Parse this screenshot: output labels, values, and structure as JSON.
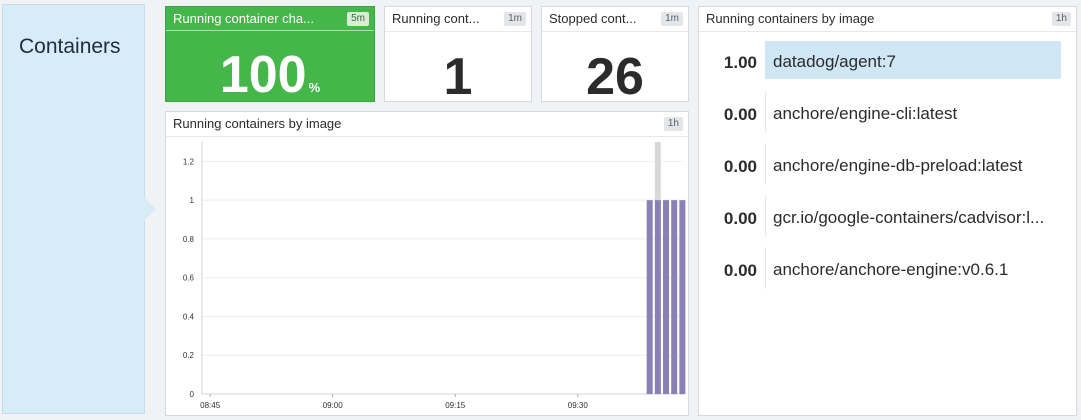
{
  "group": {
    "title": "Containers"
  },
  "change_widget": {
    "title": "Running container cha...",
    "badge": "5m",
    "value": "100",
    "unit": "%"
  },
  "running_widget": {
    "title": "Running cont...",
    "badge": "1m",
    "value": "1"
  },
  "stopped_widget": {
    "title": "Stopped cont...",
    "badge": "1m",
    "value": "26"
  },
  "timeseries_widget": {
    "title": "Running containers by image",
    "badge": "1h"
  },
  "toplist_widget": {
    "title": "Running containers by image",
    "badge": "1h",
    "rows": [
      {
        "value": "1.00",
        "name": "datadog/agent:7",
        "fraction": 1.0
      },
      {
        "value": "0.00",
        "name": "anchore/engine-cli:latest",
        "fraction": 0
      },
      {
        "value": "0.00",
        "name": "anchore/engine-db-preload:latest",
        "fraction": 0
      },
      {
        "value": "0.00",
        "name": "gcr.io/google-containers/cadvisor:l...",
        "fraction": 0
      },
      {
        "value": "0.00",
        "name": "anchore/anchore-engine:v0.6.1",
        "fraction": 0
      }
    ]
  },
  "chart_data": {
    "type": "bar",
    "title": "Running containers by image",
    "ylim": [
      0,
      1.3
    ],
    "y_ticks": [
      "0",
      "0.2",
      "0.4",
      "0.6",
      "0.8",
      "1",
      "1.2"
    ],
    "x_ticks": [
      "08:45",
      "09:00",
      "09:15",
      "09:30"
    ],
    "x_tick_minutes": [
      0,
      15,
      30,
      45
    ],
    "x_range_minutes": [
      -1,
      58
    ],
    "grid": true,
    "colors": {
      "bar": "#8a80b3",
      "highlight": "#d8d8d8",
      "grid": "#eceef0"
    },
    "series": [
      {
        "x_minutes": [
          53.8,
          54.8,
          55.8,
          56.8,
          57.8
        ],
        "values": [
          1,
          1,
          1,
          1,
          1
        ]
      }
    ],
    "highlight_minute": 54.8,
    "highlight_value": 1.3
  }
}
